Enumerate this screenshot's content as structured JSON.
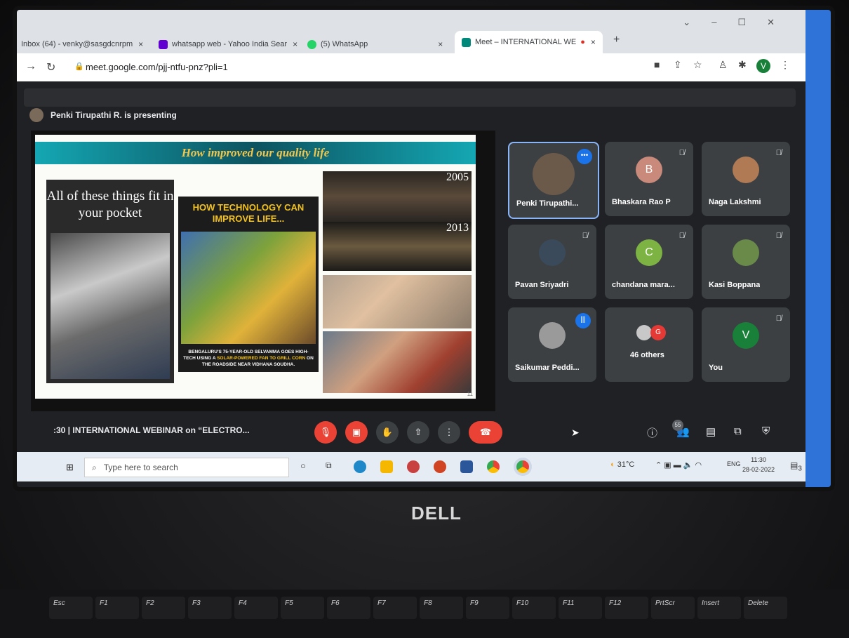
{
  "browser": {
    "tabs": [
      {
        "label": "Inbox (64) - venky@sasgdcnrpm",
        "close": "×",
        "color": "#d93025"
      },
      {
        "label": "whatsapp web - Yahoo India Sear",
        "close": "×",
        "color": "#6001d2"
      },
      {
        "label": "(5) WhatsApp",
        "close": "×",
        "color": "#25d366"
      },
      {
        "label": "Meet – INTERNATIONAL WE",
        "close": "×",
        "color": "#00897b"
      }
    ],
    "new_tab": "+",
    "window_controls": [
      "⌄",
      "–",
      "☐",
      "✕"
    ],
    "url": "meet.google.com/pjj-ntfu-pnz?pli=1",
    "profile_initial": "V"
  },
  "meet": {
    "presenter_text": "Penki Tirupathi R. is presenting",
    "meeting_title": ":30  |  INTERNATIONAL WEBINAR on “ELECTRO...",
    "participant_count": "55",
    "tiles": [
      {
        "name": "Penki Tirupathi...",
        "initial": "",
        "color": "#6b5a4a"
      },
      {
        "name": "Bhaskara Rao P",
        "initial": "B",
        "color": "#c98a7c"
      },
      {
        "name": "Naga Lakshmi",
        "initial": "",
        "color": "#b07a55"
      },
      {
        "name": "Pavan Sriyadri",
        "initial": "",
        "color": "#3a4a5a"
      },
      {
        "name": "chandana mara...",
        "initial": "C",
        "color": "#7cb342"
      },
      {
        "name": "Kasi Boppana",
        "initial": "",
        "color": "#6a8a4a"
      },
      {
        "name": "Saikumar Peddi...",
        "initial": "",
        "color": "#9a9a9a"
      },
      {
        "name": "46 others",
        "initial": "G",
        "color": "#e53935"
      },
      {
        "name": "You",
        "initial": "V",
        "color": "#188038"
      }
    ]
  },
  "slide": {
    "title": "How improved our quality life",
    "panel1_text": "All of these things fit in your pocket",
    "panel2_heading": "HOW TECHNOLOGY CAN IMPROVE LIFE...",
    "panel2_caption_a": "BENGALURU'S 75-YEAR-OLD SELVAMMA GOES HIGH-TECH USING A ",
    "panel2_caption_b": "SOLAR-POWERED FAN TO GRILL CORN",
    "panel2_caption_c": " ON THE ROADSIDE NEAR VIDHANA SOUDHA.",
    "year1": "2005",
    "year2": "2013",
    "page": "11"
  },
  "taskbar": {
    "search_placeholder": "Type here to search",
    "temperature": "31°C",
    "language": "ENG",
    "time": "11:30",
    "date": "28-02-2022",
    "notifications": "3"
  },
  "laptop": {
    "brand": "DELL",
    "keys": [
      "Esc",
      "F1",
      "F2",
      "F3",
      "F4",
      "F5",
      "F6",
      "F7",
      "F8",
      "F9",
      "F10",
      "F11",
      "F12",
      "PrtScr",
      "Insert",
      "Delete"
    ]
  }
}
